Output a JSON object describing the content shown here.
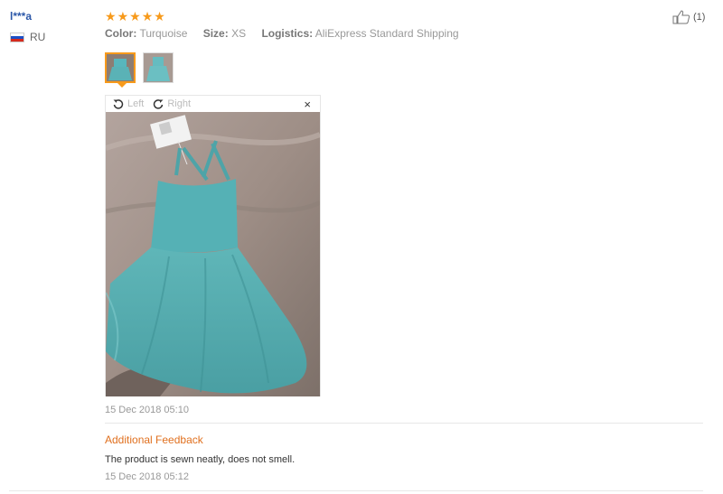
{
  "review": {
    "user_name": "l***a",
    "country": "RU",
    "rating": 5,
    "helpful_count": "(1)",
    "meta": {
      "color_label": "Color:",
      "color_value": "Turquoise",
      "size_label": "Size:",
      "size_value": "XS",
      "logistics_label": "Logistics:",
      "logistics_value": "AliExpress Standard Shipping"
    },
    "viewer": {
      "left_label": "Left",
      "right_label": "Right",
      "close_glyph": "×"
    },
    "date": "15 Dec 2018 05:10",
    "additional": {
      "title": "Additional Feedback",
      "text": "The product is sewn neatly, does not smell.",
      "date": "15 Dec 2018 05:12"
    }
  },
  "colors": {
    "star": "#f79a1b",
    "username": "#2b57a8",
    "additional_title": "#e0701f"
  }
}
